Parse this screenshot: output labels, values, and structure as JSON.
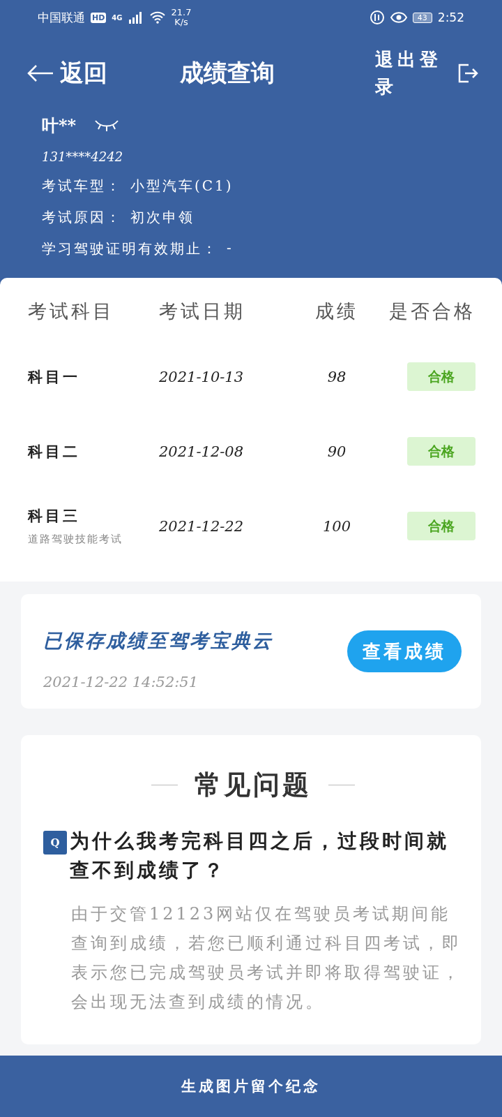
{
  "status_bar": {
    "carrier": "中国联通",
    "hd": "HD",
    "network": "4G",
    "speed_value": "21.7",
    "speed_unit": "K/s",
    "battery": "43",
    "time": "2:52"
  },
  "header": {
    "back_label": "返回",
    "title": "成绩查询",
    "logout_label": "退出登录"
  },
  "profile": {
    "name": "叶**",
    "phone": "131****4242",
    "fields": [
      {
        "label": "考试车型：",
        "value": "小型汽车(C1)"
      },
      {
        "label": "考试原因：",
        "value": "初次申领"
      },
      {
        "label": "学习驾驶证明有效期止：",
        "value": "-"
      }
    ]
  },
  "table": {
    "columns": [
      "考试科目",
      "考试日期",
      "成绩",
      "是否合格"
    ],
    "rows": [
      {
        "subject": "科目一",
        "date": "2021-10-13",
        "score": "98",
        "result": "合格",
        "passed": true
      },
      {
        "subject": "科目二",
        "date": "2021-12-08",
        "score": "90",
        "result": "合格",
        "passed": true
      },
      {
        "subject": "科目三",
        "note": "道路驾驶技能考试",
        "date": "2021-12-22",
        "score": "100",
        "result": "合格",
        "passed": true
      }
    ]
  },
  "cloud_card": {
    "title": "已保存成绩至驾考宝典云",
    "time": "2021-12-22 14:52:51",
    "button": "查看成绩"
  },
  "faq": {
    "title": "常见问题",
    "badge": "Q",
    "question": "为什么我考完科目四之后，过段时间就查不到成绩了？",
    "answer": "由于交管12123网站仅在驾驶员考试期间能查询到成绩，若您已顺利通过科目四考试，即表示您已完成驾驶员考试并即将取得驾驶证，会出现无法查到成绩的情况。"
  },
  "bottom_button": "生成图片留个纪念"
}
